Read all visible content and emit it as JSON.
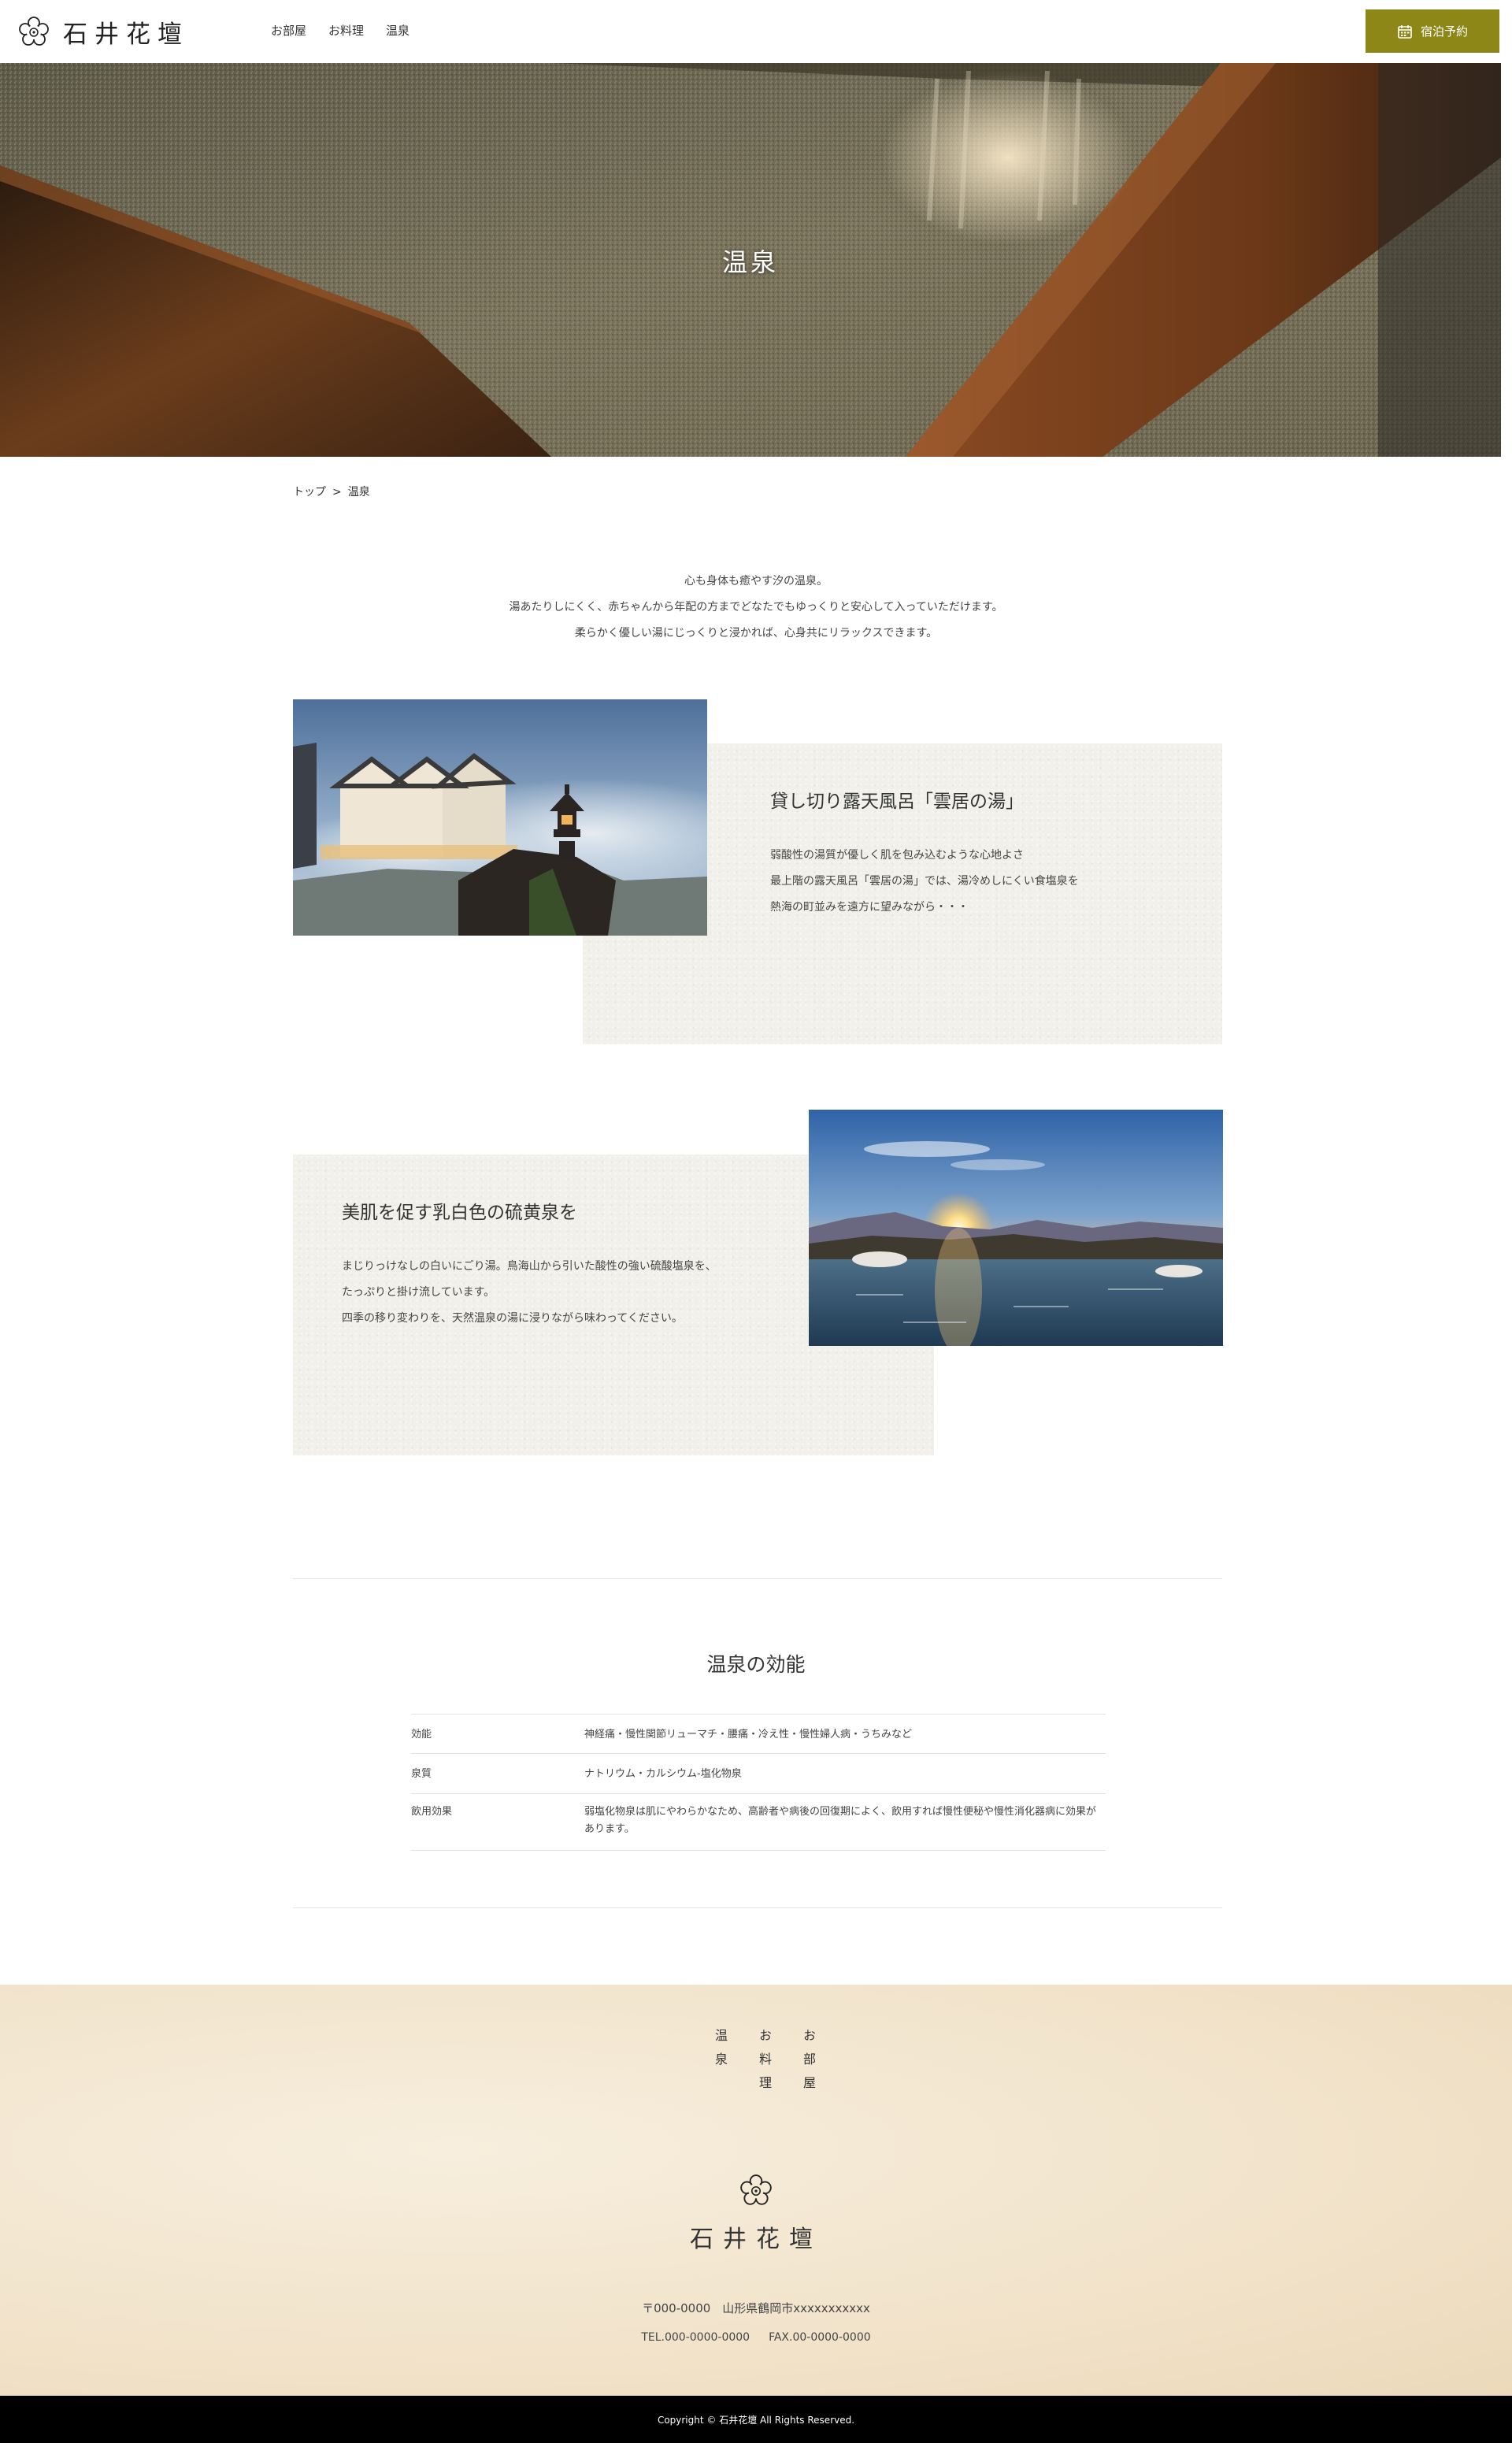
{
  "header": {
    "logo_text": "石井花壇",
    "nav": [
      "お部屋",
      "お料理",
      "温泉"
    ],
    "reserve_label": "宿泊予約"
  },
  "hero": {
    "title": "温泉"
  },
  "breadcrumb": {
    "home": "トップ",
    "separator": ">",
    "current": "温泉"
  },
  "intro": {
    "lines": [
      "心も身体も癒やす汐の温泉。",
      "湯あたりしにくく、赤ちゃんから年配の方までどなたでもゆっくりと安心して入っていただけます。",
      "柔らかく優しい湯にじっくりと浸かれば、心身共にリラックスできます。"
    ]
  },
  "features": [
    {
      "title": "貸し切り露天風呂「雲居の湯」",
      "lines": [
        "弱酸性の湯質が優しく肌を包み込むような心地よさ",
        "最上階の露天風呂「雲居の湯」では、湯冷めしにくい食塩泉を",
        "熱海の町並みを遠方に望みながら・・・"
      ]
    },
    {
      "title": "美肌を促す乳白色の硫黄泉を",
      "lines": [
        "まじりっけなしの白いにごり湯。鳥海山から引いた酸性の強い硫酸塩泉を、",
        "たっぷりと掛け流しています。",
        "四季の移り変わりを、天然温泉の湯に浸りながら味わってください。"
      ]
    }
  ],
  "efficacy": {
    "title": "温泉の効能",
    "rows": [
      {
        "key": "効能",
        "value": "神経痛・慢性関節リューマチ・腰痛・冷え性・慢性婦人病・うちみなど"
      },
      {
        "key": "泉質",
        "value": "ナトリウム・カルシウム-塩化物泉"
      },
      {
        "key": "飲用効果",
        "value": "弱塩化物泉は肌にやわらかなため、高齢者や病後の回復期によく、飲用すれば慢性便秘や慢性消化器病に効果があります。"
      }
    ]
  },
  "footer": {
    "nav": [
      "温泉",
      "お料理",
      "お部屋"
    ],
    "logo_text": "石井花壇",
    "address": "〒000-0000　山形県鶴岡市xxxxxxxxxxx",
    "tel": "TEL.000-0000-0000",
    "fax": "FAX.00-0000-0000",
    "copyright": "Copyright © 石井花壇 All Rights Reserved."
  },
  "colors": {
    "accent": "#8c8716",
    "paper": "#f1f0eb",
    "footer_bg": "#f2e4cc",
    "copyright_bg": "#000000"
  },
  "icons": {
    "logo": "flower-emblem-icon",
    "reserve": "calendar-icon"
  }
}
